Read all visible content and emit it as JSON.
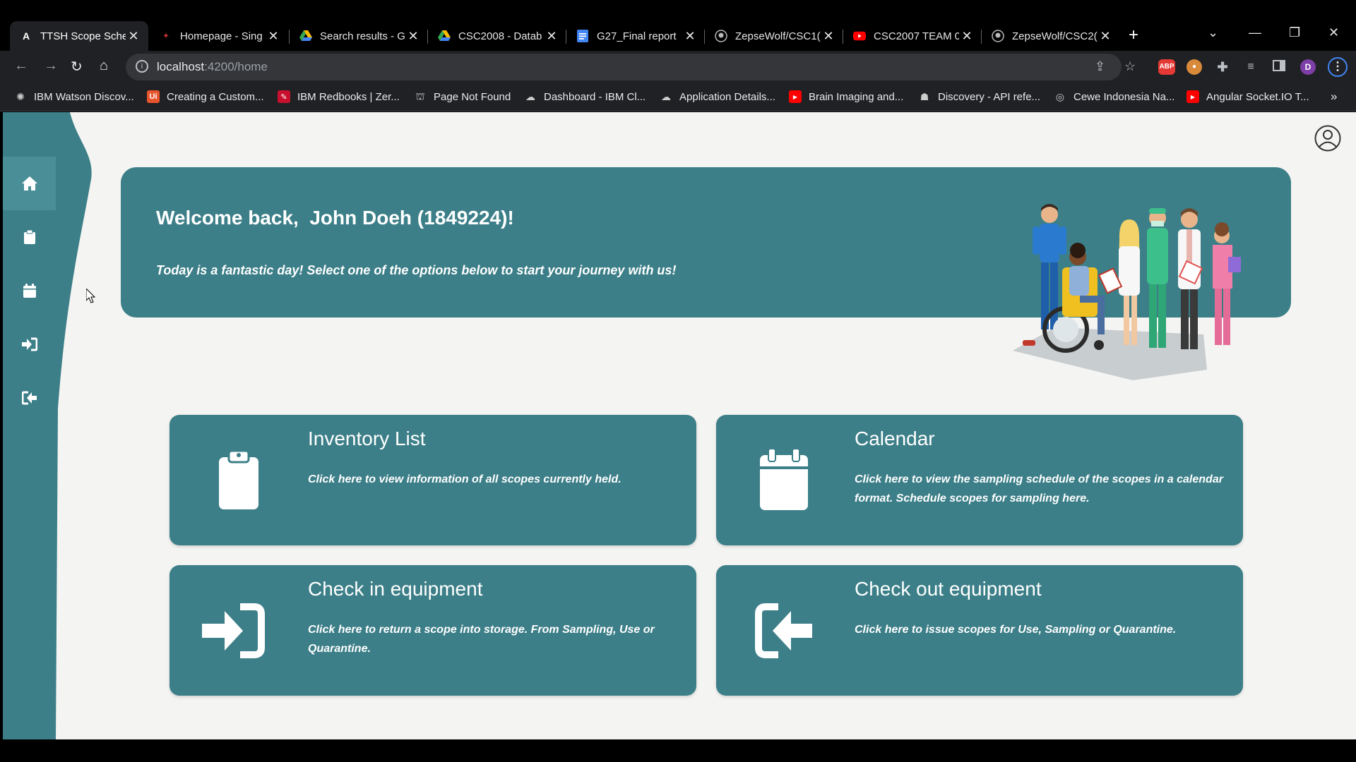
{
  "browser": {
    "tabs": [
      {
        "title": "TTSH Scope Sche",
        "icon": "angular-icon",
        "active": true
      },
      {
        "title": "Homepage - Sing",
        "icon": "site-icon"
      },
      {
        "title": "Search results - G",
        "icon": "drive-icon"
      },
      {
        "title": "CSC2008 - Datab",
        "icon": "drive-icon"
      },
      {
        "title": "G27_Final report",
        "icon": "docs-icon"
      },
      {
        "title": "ZepseWolf/CSC1(",
        "icon": "github-icon"
      },
      {
        "title": "CSC2007 TEAM 0",
        "icon": "youtube-icon"
      },
      {
        "title": "ZepseWolf/CSC2(",
        "icon": "github-icon"
      }
    ],
    "new_tab": "+",
    "address": {
      "host": "localhost",
      "path": ":4200/home"
    },
    "profile_initial": "D",
    "abp_label": "ABP",
    "bookmarks_more": "»",
    "bookmarks": [
      {
        "label": "IBM Watson Discov...",
        "color": "#202124"
      },
      {
        "label": "Creating a Custom...",
        "color": "#e8542c"
      },
      {
        "label": "IBM Redbooks | Zer...",
        "color": "#c8102e"
      },
      {
        "label": "Page Not Found",
        "color": "#202124"
      },
      {
        "label": "Dashboard - IBM Cl...",
        "color": "#202124"
      },
      {
        "label": "Application Details...",
        "color": "#202124"
      },
      {
        "label": "Brain Imaging and...",
        "color": "#ff0000"
      },
      {
        "label": "Discovery - API refe...",
        "color": "#202124"
      },
      {
        "label": "Cewe Indonesia Na...",
        "color": "#202124"
      },
      {
        "label": "Angular Socket.IO T...",
        "color": "#ff0000"
      }
    ]
  },
  "sidebar": {
    "items": [
      {
        "name": "home",
        "icon": "home-icon",
        "active": true
      },
      {
        "name": "inventory",
        "icon": "clipboard-icon"
      },
      {
        "name": "calendar",
        "icon": "calendar-icon"
      },
      {
        "name": "check-in",
        "icon": "sign-in-icon"
      },
      {
        "name": "check-out",
        "icon": "sign-out-icon"
      }
    ]
  },
  "banner": {
    "welcome": "Welcome back,  John Doeh (1849224)!",
    "subtitle": "Today is a fantastic day! Select one of the options below to start your journey with us!"
  },
  "cards": [
    {
      "title": "Inventory List",
      "description": "Click here to view information of all scopes currently held.",
      "icon": "clipboard-icon"
    },
    {
      "title": "Calendar",
      "description": "Click here to view the sampling schedule of the scopes in a calendar format. Schedule scopes for sampling here.",
      "icon": "calendar-icon"
    },
    {
      "title": "Check in equipment",
      "description": "Click here to return a scope into storage. From Sampling, Use or Quarantine.",
      "icon": "sign-in-icon"
    },
    {
      "title": "Check out equipment",
      "description": "Click here to issue scopes for Use, Sampling or Quarantine.",
      "icon": "sign-out-icon"
    }
  ],
  "colors": {
    "teal": "#3c7f88",
    "sidebar_active": "#4a8f97",
    "page_bg": "#f4f4f2"
  }
}
